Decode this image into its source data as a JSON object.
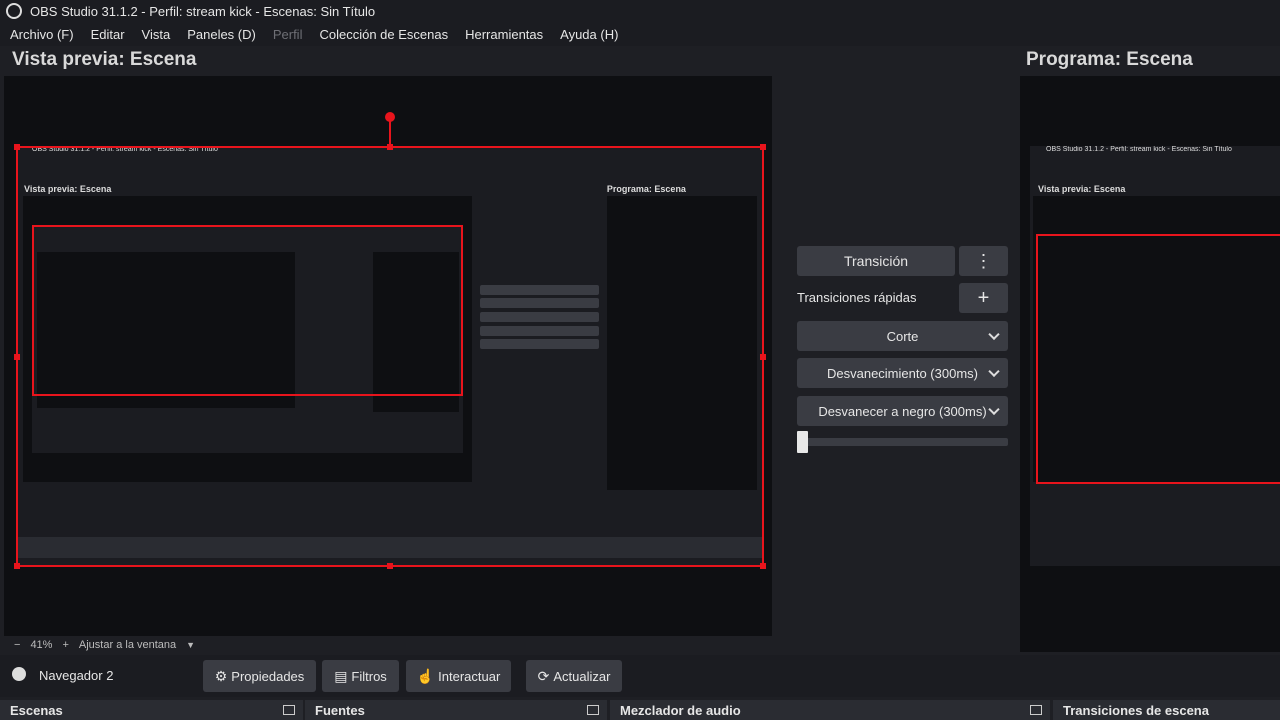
{
  "window": {
    "title": "OBS Studio 31.1.2 - Perfil: stream kick - Escenas: Sin Título"
  },
  "menu": [
    "Archivo (F)",
    "Editar",
    "Vista",
    "Paneles (D)",
    "Perfil",
    "Colección de Escenas",
    "Herramientas",
    "Ayuda (H)"
  ],
  "headers": {
    "preview": "Vista previa: Escena",
    "program": "Programa: Escena"
  },
  "transitions": {
    "transition_label": "Transición",
    "more_icon": "⋮",
    "quick_label": "Transiciones rápidas",
    "add_icon": "+",
    "items": [
      "Corte",
      "Desvanecimiento (300ms)",
      "Desvanecer a negro (300ms)"
    ],
    "slider_value": 0
  },
  "zoom": {
    "minus": "−",
    "value": "41%",
    "plus": "+",
    "fit": "Ajustar a la ventana"
  },
  "controls": {
    "source_name": "Navegador 2",
    "properties": "Propiedades",
    "filters": "Filtros",
    "interact": "Interactuar",
    "refresh": "Actualizar"
  },
  "docks": [
    "Escenas",
    "Fuentes",
    "Mezclador de audio",
    "Transiciones de escena"
  ],
  "colors": {
    "accent": "#e8141c",
    "button": "#3a3c43",
    "background": "#1e1f24"
  }
}
